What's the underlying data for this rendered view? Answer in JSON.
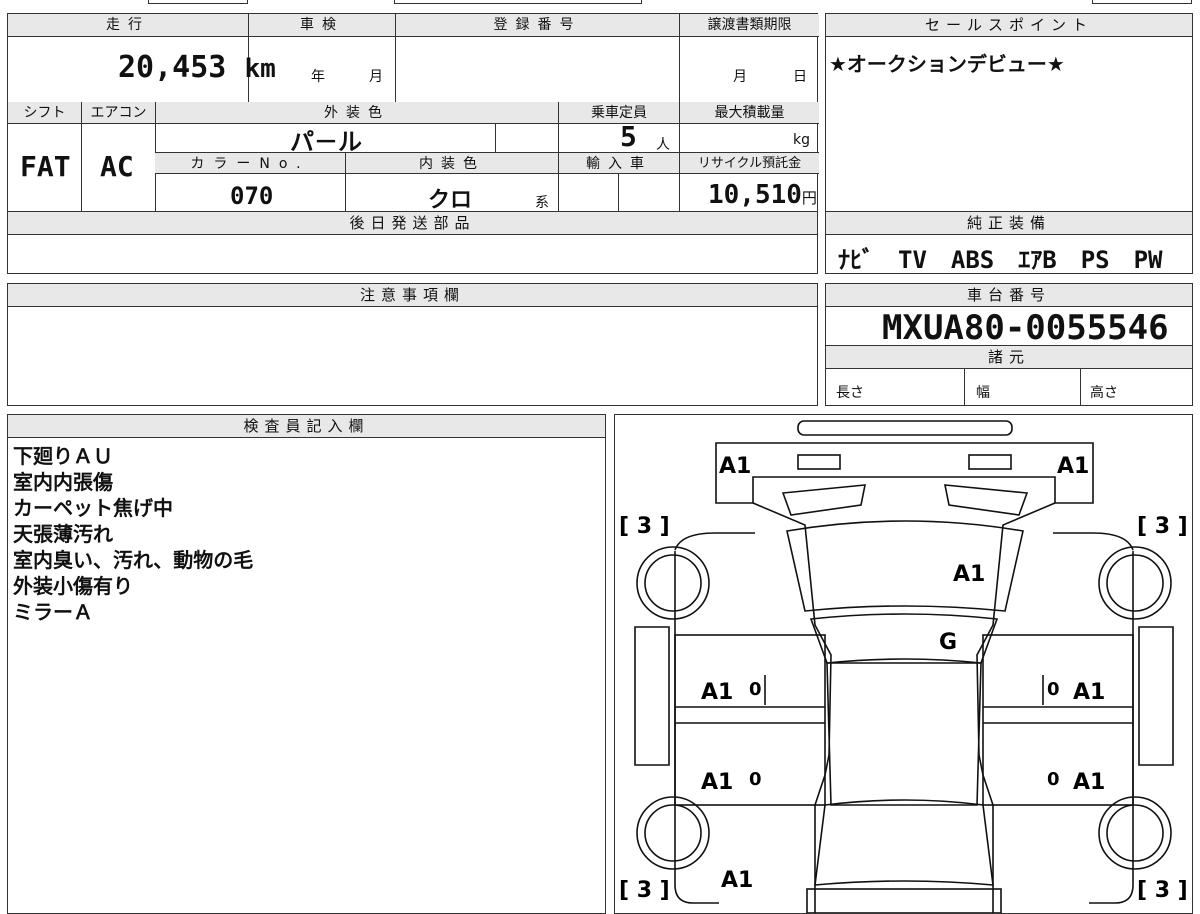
{
  "top_left": {
    "headers": {
      "mileage": "走行",
      "shaken": "車検",
      "registration": "登録番号",
      "transfer_deadline": "譲渡書類期限",
      "shift": "シフト",
      "aircon": "エアコン",
      "exterior_color": "外装色",
      "capacity": "乗車定員",
      "max_load": "最大積載量",
      "color_no": "カラーNo.",
      "interior_color": "内装色",
      "import": "輸入車",
      "recycle": "リサイクル預託金",
      "later_parts": "後日発送部品",
      "notes": "注意事項欄",
      "inspector": "検査員記入欄"
    },
    "mileage_value": "20,453",
    "mileage_unit": "km",
    "shaken_year": "年",
    "shaken_month": "月",
    "transfer_month": "月",
    "transfer_day": "日",
    "shift_value": "FAT",
    "aircon_value": "AC",
    "exterior_value": "パ－ル",
    "capacity_value": "5",
    "capacity_unit": "人",
    "max_load_unit": "kg",
    "color_no_value": "070",
    "interior_value": "クロ",
    "interior_suffix": "系",
    "recycle_value": "10,510",
    "recycle_unit": "円"
  },
  "sales_point": {
    "header": "セールスポイント",
    "text": "★オークションデビュー★"
  },
  "equipment": {
    "header": "純正装備",
    "text": "ﾅﾋﾞ　TV　ABS　ｴｱB　PS　PW"
  },
  "chassis": {
    "header": "車台番号",
    "value": "MXUA80-0055546",
    "spec_header": "諸元",
    "length": "長さ",
    "width": "幅",
    "height": "高さ"
  },
  "inspector_notes": [
    "下廻りＡＵ",
    "室内内張傷",
    "カーペット焦げ中",
    "天張薄汚れ",
    "室内臭い、汚れ、動物の毛",
    "外装小傷有り",
    "ミラーＡ"
  ],
  "diagram": {
    "labels": {
      "front_left": "A1",
      "front_right": "A1",
      "bracket_tl": "[ 3 ]",
      "bracket_tr": "[ 3 ]",
      "bracket_bl": "[ 3 ]",
      "bracket_br": "[ 3 ]",
      "hood": "A1",
      "windshield": "G",
      "door_fl": "A1",
      "door_fr": "A1",
      "door_rl": "A1",
      "door_rr": "A1",
      "door_fl_mark": "0",
      "door_fr_mark": "0",
      "door_rl_mark": "0",
      "door_rr_mark": "0",
      "rear": "A1"
    }
  }
}
